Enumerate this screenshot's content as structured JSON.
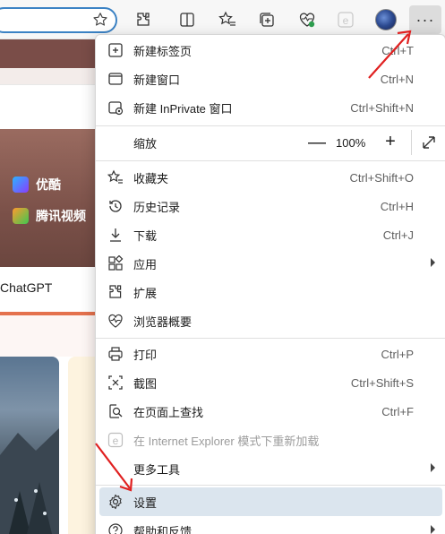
{
  "menu": {
    "items": [
      {
        "label": "新建标签页",
        "shortcut": "Ctrl+T"
      },
      {
        "label": "新建窗口",
        "shortcut": "Ctrl+N"
      },
      {
        "label": "新建 InPrivate 窗口",
        "shortcut": "Ctrl+Shift+N"
      },
      {
        "label": "收藏夹",
        "shortcut": "Ctrl+Shift+O"
      },
      {
        "label": "历史记录",
        "shortcut": "Ctrl+H"
      },
      {
        "label": "下载",
        "shortcut": "Ctrl+J"
      },
      {
        "label": "应用",
        "shortcut": ""
      },
      {
        "label": "扩展",
        "shortcut": ""
      },
      {
        "label": "浏览器概要",
        "shortcut": ""
      },
      {
        "label": "打印",
        "shortcut": "Ctrl+P"
      },
      {
        "label": "截图",
        "shortcut": "Ctrl+Shift+S"
      },
      {
        "label": "在页面上查找",
        "shortcut": "Ctrl+F"
      },
      {
        "label": "在 Internet Explorer 模式下重新加载",
        "shortcut": ""
      },
      {
        "label": "更多工具",
        "shortcut": ""
      },
      {
        "label": "设置",
        "shortcut": ""
      },
      {
        "label": "帮助和反馈",
        "shortcut": ""
      }
    ],
    "zoom": {
      "label": "缩放",
      "minus": "—",
      "value": "100%",
      "plus": "+"
    }
  },
  "toolbar": {
    "more_label": "···"
  },
  "background_page": {
    "sites": [
      "优酷",
      "腾讯视频"
    ],
    "chatgpt": "ChatGPT"
  },
  "colors": {
    "highlight": "#dbe5ee",
    "arrow": "#e02020",
    "accent": "#3b82c4"
  }
}
